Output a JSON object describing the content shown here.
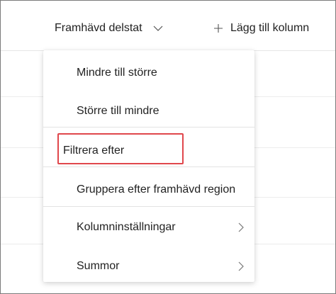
{
  "header": {
    "column_title": "Framhävd delstat",
    "add_column_label": "Lägg till kolumn"
  },
  "menu": {
    "items": [
      {
        "label": "Mindre till större",
        "has_submenu": false
      },
      {
        "label": "Större till mindre",
        "has_submenu": false
      },
      {
        "label": "Filtrera efter",
        "has_submenu": false
      },
      {
        "label": "Gruppera efter framhävd region",
        "has_submenu": false
      },
      {
        "label": "Kolumninställningar",
        "has_submenu": true
      },
      {
        "label": "Summor",
        "has_submenu": true
      }
    ]
  },
  "colors": {
    "highlight": "#e0474c",
    "divider": "#e3e3e3",
    "text": "#222222"
  }
}
